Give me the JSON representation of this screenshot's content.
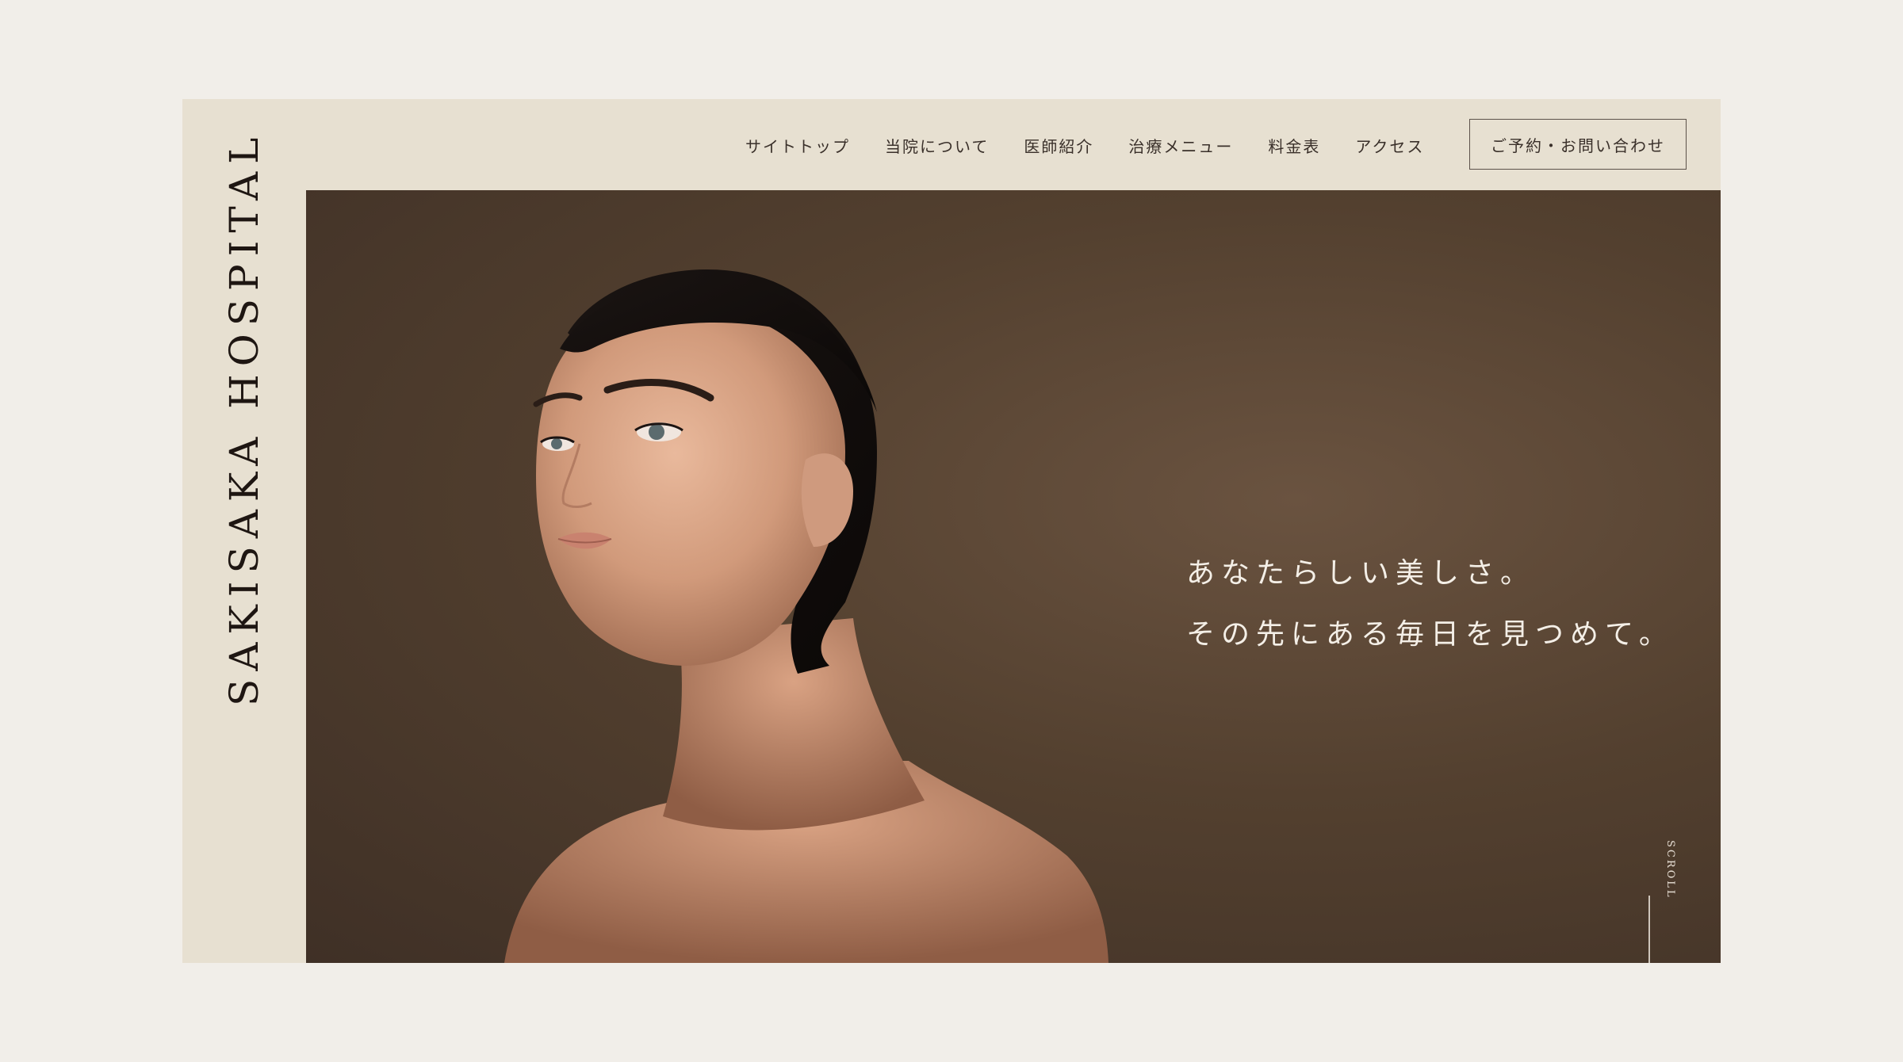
{
  "brand": {
    "name": "SAKISAKA HOSPITAL"
  },
  "nav": {
    "items": [
      {
        "label": "サイトトップ"
      },
      {
        "label": "当院について"
      },
      {
        "label": "医師紹介"
      },
      {
        "label": "治療メニュー"
      },
      {
        "label": "料金表"
      },
      {
        "label": "アクセス"
      }
    ],
    "reserve_label": "ご予約・お問い合わせ"
  },
  "hero": {
    "line1": "あなたらしい美しさ。",
    "line2": "その先にある毎日を見つめて。",
    "scroll_label": "SCROLL"
  },
  "colors": {
    "page_bg": "#f1eee9",
    "frame_bg": "#e7e0d1",
    "hero_bg": "#53402f",
    "text_dark": "#1e1612"
  }
}
